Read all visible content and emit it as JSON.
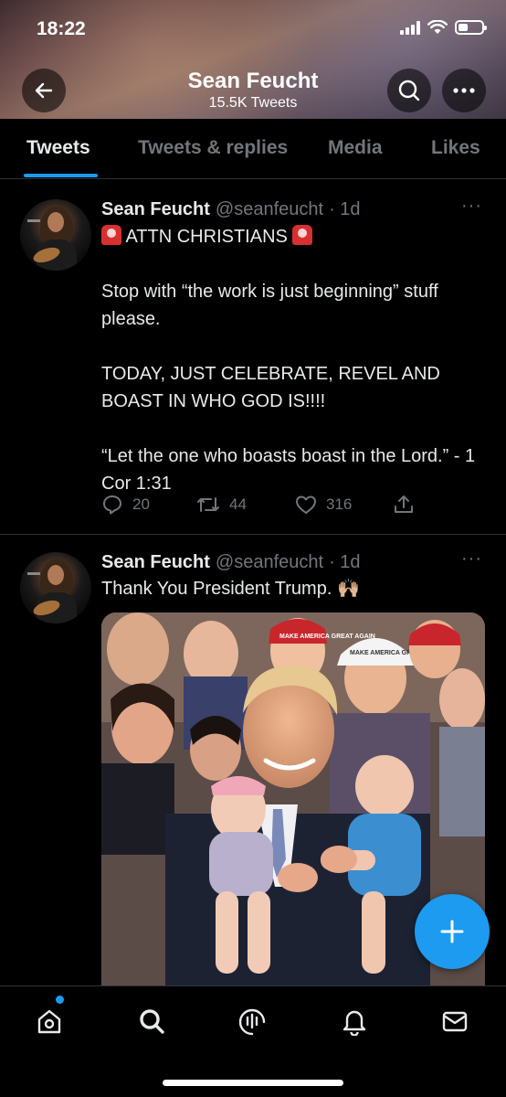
{
  "status_bar": {
    "time": "18:22"
  },
  "header": {
    "name": "Sean Feucht",
    "tweet_count": "15.5K Tweets"
  },
  "tabs": [
    {
      "label": "Tweets",
      "active": true
    },
    {
      "label": "Tweets & replies",
      "active": false
    },
    {
      "label": "Media",
      "active": false
    },
    {
      "label": "Likes",
      "active": false
    }
  ],
  "tweets": [
    {
      "name": "Sean Feucht",
      "handle": "@seanfeucht",
      "time": "· 1d",
      "more": "···",
      "lines": [
        "ATTN CHRISTIANS",
        "Stop with “the work is just beginning” stuff please.",
        "TODAY, JUST CELEBRATE, REVEL AND BOAST IN WHO GOD IS!!!!",
        "“Let the one who boasts boast in the Lord.” - 1 Cor 1:31"
      ],
      "replies": "20",
      "retweets": "44",
      "likes": "316"
    },
    {
      "name": "Sean Feucht",
      "handle": "@seanfeucht",
      "time": "· 1d",
      "more": "···",
      "text": "Thank You President Trump.",
      "emoji": "🙌🏼",
      "image": "Crowd photo: Donald Trump smiling while holding two babies, surrounded by supporters in MAKE AMERICA GREAT AGAIN hats",
      "image_caps": [
        "MAKE AMERICA GREAT AGAIN",
        "MAKE AMERICA GREAT AGAIN"
      ]
    }
  ],
  "icons": {
    "back": "arrow-left-icon",
    "search": "search-icon",
    "more": "more-icon",
    "compose": "plus-icon",
    "nav": [
      "home-icon",
      "search-icon",
      "spaces-icon",
      "notifications-icon",
      "messages-icon"
    ]
  },
  "colors": {
    "accent": "#1d9bf0",
    "background": "#000000",
    "muted": "#71767b"
  }
}
